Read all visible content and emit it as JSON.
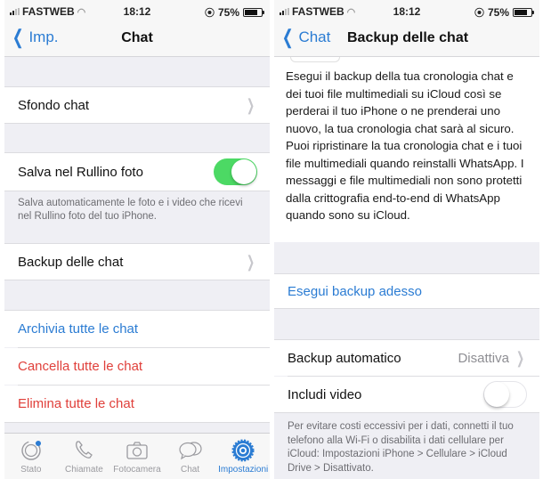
{
  "left": {
    "status": {
      "carrier": "FASTWEB",
      "time": "18:12",
      "battery": "75%",
      "battery_level": 0.75
    },
    "nav": {
      "back_label": "Imp.",
      "title": "Chat"
    },
    "rows": {
      "wallpaper": "Sfondo chat",
      "save_to_roll": "Salva nel Rullino foto",
      "save_to_roll_on": true,
      "save_to_roll_footnote": "Salva automaticamente le foto e i video che ricevi nel Rullino foto del tuo iPhone.",
      "backup": "Backup delle chat",
      "archive_all": "Archivia tutte le chat",
      "clear_all": "Cancella tutte le chat",
      "delete_all": "Elimina tutte le chat"
    },
    "tabs": [
      {
        "label": "Stato",
        "icon": "status-icon",
        "active": false
      },
      {
        "label": "Chiamate",
        "icon": "phone-icon",
        "active": false
      },
      {
        "label": "Fotocamera",
        "icon": "camera-icon",
        "active": false
      },
      {
        "label": "Chat",
        "icon": "chat-bubbles-icon",
        "active": false
      },
      {
        "label": "Impostazioni",
        "icon": "settings-gear-icon",
        "active": true
      }
    ]
  },
  "right": {
    "status": {
      "carrier": "FASTWEB",
      "time": "18:12",
      "battery": "75%",
      "battery_level": 0.75
    },
    "nav": {
      "back_label": "Chat",
      "title": "Backup delle chat"
    },
    "description": "Esegui il backup della tua cronologia chat e dei tuoi file multimediali su iCloud così se perderai il tuo iPhone o ne prenderai uno nuovo, la tua cronologia chat sarà al sicuro. Puoi ripristinare la tua cronologia chat e i tuoi file multimediali quando reinstalli WhatsApp. I messaggi e file multimediali non sono protetti dalla crittografia end-to-end di WhatsApp quando sono su iCloud.",
    "backup_now": "Esegui backup adesso",
    "auto_backup": {
      "label": "Backup automatico",
      "value": "Disattiva"
    },
    "include_video": {
      "label": "Includi video",
      "on": false
    },
    "footnote": "Per evitare costi eccessivi per i dati, connetti il tuo telefono alla Wi-Fi o disabilita i dati cellulare per iCloud: Impostazioni iPhone > Cellulare > iCloud Drive > Disattivato."
  },
  "colors": {
    "accent": "#2b7cd3",
    "destructive": "#e0403b",
    "toggle_on": "#4cd964",
    "group_bg": "#efeff4"
  }
}
